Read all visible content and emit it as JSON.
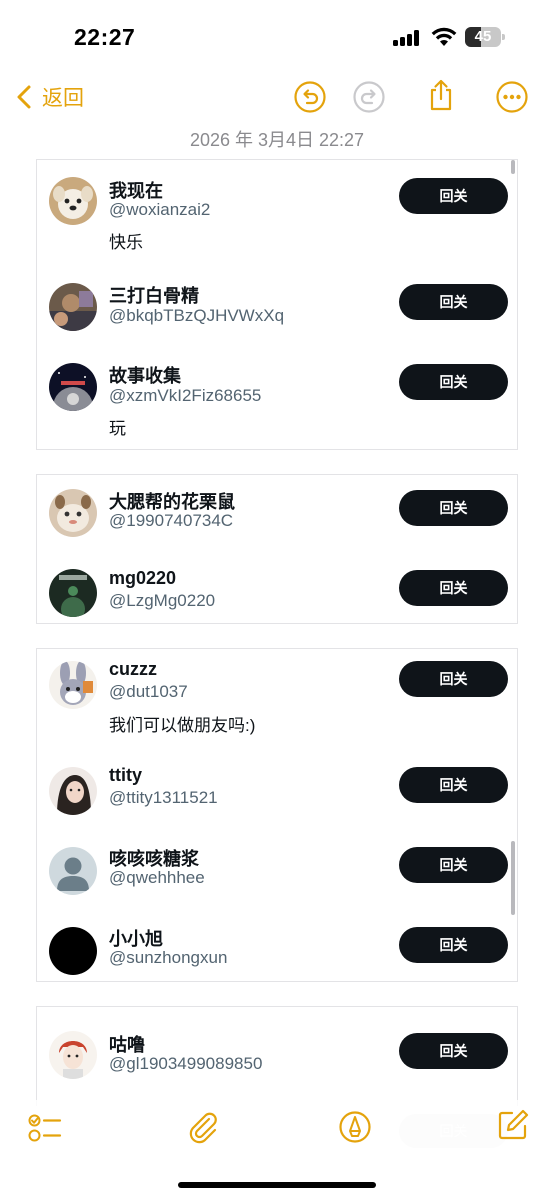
{
  "status_bar": {
    "time": "22:27",
    "battery": "45",
    "battery_level": 0.45
  },
  "nav": {
    "back_label": "返回"
  },
  "note": {
    "date": "2026 年 3月4日 22:27"
  },
  "accent_color": "#e4a30c",
  "icons": {
    "back": "chevron-left-icon",
    "undo": "undo-icon",
    "redo": "redo-icon",
    "share": "share-icon",
    "more": "more-icon",
    "checklist": "checklist-icon",
    "attach": "paperclip-icon",
    "markup": "pen-icon",
    "compose": "compose-icon"
  },
  "cards": [
    {
      "users": [
        {
          "name": "我现在",
          "handle": "@woxianzai2",
          "bio": "快乐",
          "button": "回关"
        },
        {
          "name": "三打白骨精",
          "handle": "@bkqbTBzQJHVWxXq",
          "bio": "",
          "button": "回关"
        },
        {
          "name": "故事收集",
          "handle": "@xzmVkI2Fiz68655",
          "bio": "玩",
          "button": "回关"
        }
      ]
    },
    {
      "users": [
        {
          "name": "大腮帮的花栗鼠",
          "handle": "@1990740734C",
          "bio": "",
          "button": "回关"
        },
        {
          "name": "mg0220",
          "handle": "@LzgMg0220",
          "bio": "",
          "button": "回关"
        }
      ]
    },
    {
      "users": [
        {
          "name": "cuzzz",
          "handle": "@dut1037",
          "bio": "我们可以做朋友吗:)",
          "button": "回关"
        },
        {
          "name": "ttity",
          "handle": "@ttity1311521",
          "bio": "",
          "button": "回关"
        },
        {
          "name": "咳咳咳糖浆",
          "handle": "@qwehhhee",
          "bio": "",
          "button": "回关"
        },
        {
          "name": "小小旭",
          "handle": "@sunzhongxun",
          "bio": "",
          "button": "回关"
        }
      ]
    },
    {
      "users": [
        {
          "name": "咕噜",
          "handle": "@gl1903499089850",
          "bio": "",
          "button": "回关"
        }
      ]
    }
  ],
  "faded_bottom": {
    "button": "回关"
  }
}
